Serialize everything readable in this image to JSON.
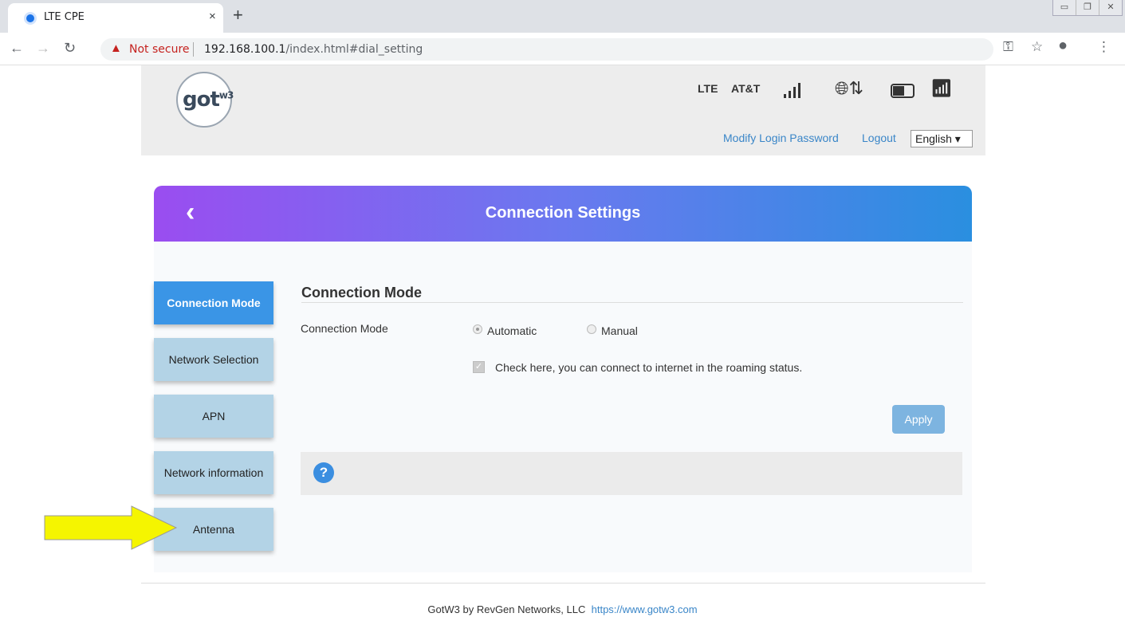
{
  "browser": {
    "tab_title": "LTE CPE",
    "tab_close": "×",
    "new_tab": "+",
    "not_secure": "Not secure",
    "url_host": "192.168.100.1",
    "url_rest": "/index.html#dial_setting"
  },
  "header": {
    "logo_text": "got",
    "logo_sup": "w3",
    "network_type": "LTE",
    "carrier": "AT&T",
    "modify_password": "Modify Login Password",
    "logout": "Logout",
    "language": "English ▾"
  },
  "page": {
    "title": "Connection Settings",
    "sidebar": [
      {
        "label": "Connection Mode",
        "active": true
      },
      {
        "label": "Network Selection",
        "active": false
      },
      {
        "label": "APN",
        "active": false
      },
      {
        "label": "Network information",
        "active": false
      },
      {
        "label": "Antenna",
        "active": false
      }
    ],
    "section_title": "Connection Mode",
    "field_label": "Connection Mode",
    "option_automatic": "Automatic",
    "option_manual": "Manual",
    "selected_mode": "Automatic",
    "roaming_checked": true,
    "roaming_text": "Check here, you can connect to internet in the roaming status.",
    "apply": "Apply",
    "help": "?"
  },
  "footer": {
    "company": "GotW3 by RevGen Networks, LLC",
    "url": "https://www.gotw3.com"
  },
  "colors": {
    "banner_start": "#9a4df0",
    "banner_end": "#2a8fe0",
    "active_tab": "#3a95e6",
    "inactive_tab": "#b3d3e6",
    "link": "#3a86c8",
    "arrow": "#f5f500"
  }
}
